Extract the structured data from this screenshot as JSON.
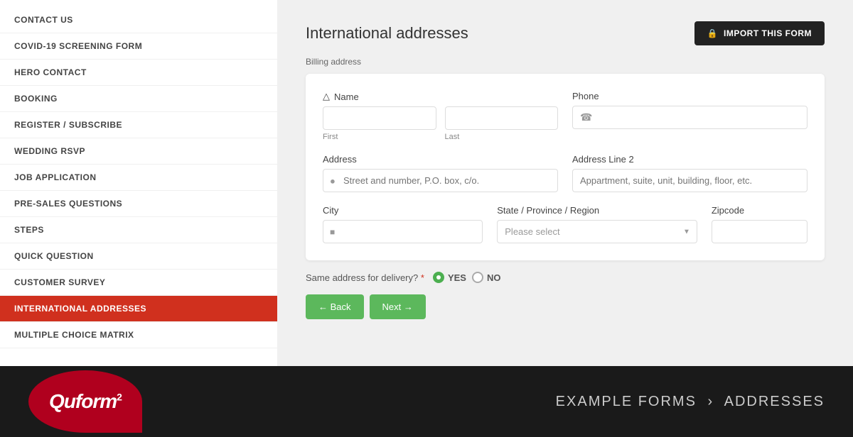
{
  "sidebar": {
    "items": [
      {
        "id": "contact-us",
        "label": "CONTACT US",
        "active": false
      },
      {
        "id": "covid-screening",
        "label": "COVID-19 SCREENING FORM",
        "active": false
      },
      {
        "id": "hero-contact",
        "label": "HERO CONTACT",
        "active": false
      },
      {
        "id": "booking",
        "label": "BOOKING",
        "active": false
      },
      {
        "id": "register-subscribe",
        "label": "REGISTER / SUBSCRIBE",
        "active": false
      },
      {
        "id": "wedding-rsvp",
        "label": "WEDDING RSVP",
        "active": false
      },
      {
        "id": "job-application",
        "label": "JOB APPLICATION",
        "active": false
      },
      {
        "id": "pre-sales-questions",
        "label": "PRE-SALES QUESTIONS",
        "active": false
      },
      {
        "id": "steps",
        "label": "STEPS",
        "active": false
      },
      {
        "id": "quick-question",
        "label": "QUICK QUESTION",
        "active": false
      },
      {
        "id": "customer-survey",
        "label": "CUSTOMER SURVEY",
        "active": false
      },
      {
        "id": "international-addresses",
        "label": "INTERNATIONAL ADDRESSES",
        "active": true
      },
      {
        "id": "multiple-choice-matrix",
        "label": "MULTIPLE CHOICE MATRIX",
        "active": false
      }
    ]
  },
  "header": {
    "page_title": "International addresses",
    "import_button": "IMPORT THIS FORM"
  },
  "form": {
    "section_label": "Billing address",
    "name_label": "Name",
    "first_label": "First",
    "last_label": "Last",
    "phone_label": "Phone",
    "address_label": "Address",
    "address_placeholder": "Street and number, P.O. box, c/o.",
    "address2_label": "Address Line 2",
    "address2_placeholder": "Appartment, suite, unit, building, floor, etc.",
    "city_label": "City",
    "state_label": "State / Province / Region",
    "state_placeholder": "Please select",
    "zipcode_label": "Zipcode",
    "delivery_question": "Same address for delivery?",
    "delivery_required": "*",
    "delivery_yes": "YES",
    "delivery_no": "NO"
  },
  "buttons": {
    "back": "← Back",
    "next": "Next →"
  },
  "footer": {
    "logo_text": "Quform",
    "logo_sup": "2",
    "breadcrumb_prefix": "EXAMPLE FORMS",
    "breadcrumb_arrow": "›",
    "breadcrumb_suffix": "ADDRESSES"
  },
  "icons": {
    "person": "&#9998;",
    "phone": "&#9742;",
    "pin": "&#9679;",
    "building": "&#9632;",
    "lock": "&#128274;"
  }
}
